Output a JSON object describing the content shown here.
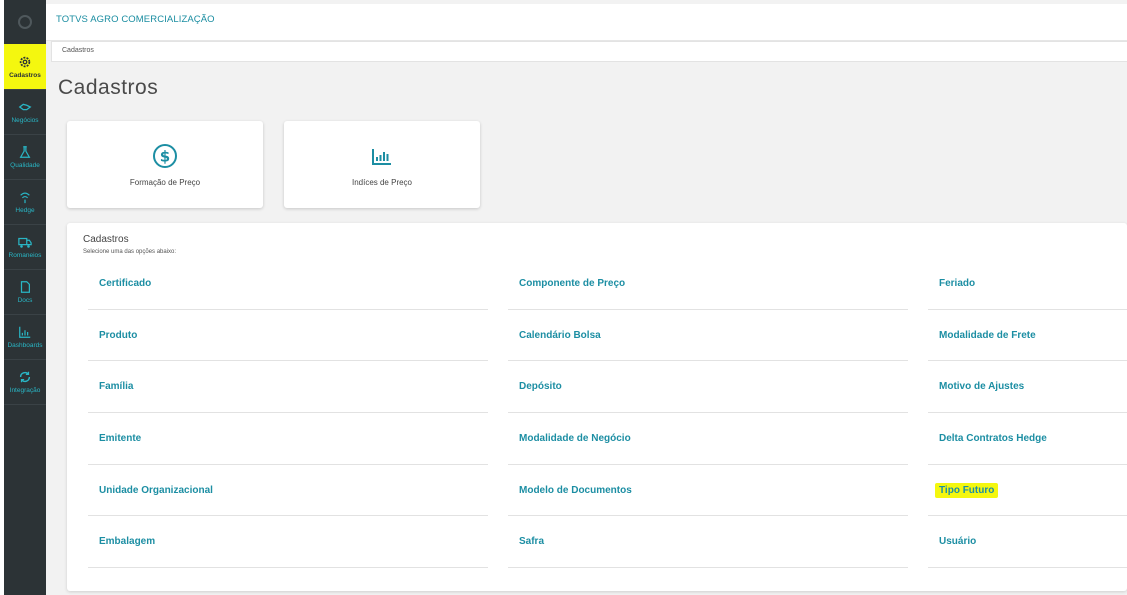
{
  "app": {
    "title": "TOTVS AGRO COMERCIALIZAÇÃO"
  },
  "breadcrumb": "Cadastros",
  "page_title": "Cadastros",
  "colors": {
    "accent": "#1c8ea3",
    "highlight": "#f4f70f",
    "sidebar": "#2c3336"
  },
  "sidebar": {
    "items": [
      {
        "label": "Cadastros",
        "icon": "gear-icon"
      },
      {
        "label": "Negócios",
        "icon": "handshake-icon"
      },
      {
        "label": "Qualidade",
        "icon": "flask-icon"
      },
      {
        "label": "Hedge",
        "icon": "signal-icon"
      },
      {
        "label": "Romaneios",
        "icon": "truck-icon"
      },
      {
        "label": "Docs",
        "icon": "document-icon"
      },
      {
        "label": "Dashboards",
        "icon": "bar-chart-icon"
      },
      {
        "label": "Integração",
        "icon": "sync-icon"
      }
    ]
  },
  "cards": [
    {
      "label": "Formação de Preço",
      "icon": "dollar-circle-icon"
    },
    {
      "label": "Indíces de Preço",
      "icon": "bar-chart-icon"
    }
  ],
  "panel": {
    "title": "Cadastros",
    "subtitle": "Selecione uma das opções abaixo:",
    "columns": [
      [
        "Certificado",
        "Produto",
        "Família",
        "Emitente",
        "Unidade Organizacional",
        "Embalagem"
      ],
      [
        "Componente de Preço",
        "Calendário Bolsa",
        "Depósito",
        "Modalidade de Negócio",
        "Modelo de Documentos",
        "Safra"
      ],
      [
        "Feriado",
        "Modalidade de Frete",
        "Motivo de Ajustes",
        "Delta Contratos Hedge",
        "Tipo Futuro",
        "Usuário"
      ]
    ]
  }
}
